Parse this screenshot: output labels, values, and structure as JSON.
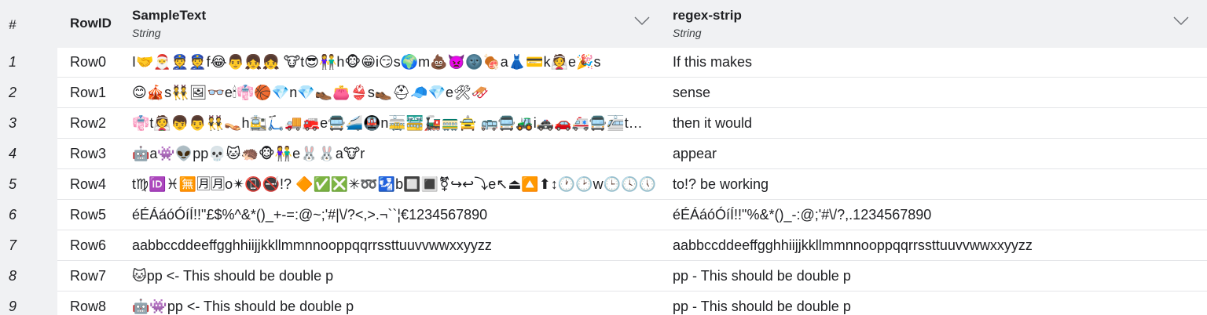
{
  "header": {
    "index_label": "#",
    "rowid_label": "RowID",
    "columns": [
      {
        "name": "SampleText",
        "type": "String"
      },
      {
        "name": "regex-strip",
        "type": "String"
      }
    ],
    "dropdown_icon": "chevron-down-icon"
  },
  "rows": [
    {
      "index": "1",
      "rowid": "Row0",
      "sample": "I🤝🎅👮👮f😂👨👧👧 🐮t😎👫h🐵😁i😏s🌍m💩👿🌚🍖a👗💳k👰e🎉s",
      "strip": "If  this makes"
    },
    {
      "index": "2",
      "rowid": "Row1",
      "sample": "😊🎪s👯🖼👓e🕯👘🏀💎n💎👞👛👙s👞⛑🧢💎e🛠🛷",
      "strip": "sense"
    },
    {
      "index": "3",
      "rowid": "Row2",
      "sample": "👘t👰👦👨👯👡h🚉🛴🚚🚒e🚍🚄🚇n🚋🚟🚂🚃🚖 🚌🚍🚜i🚓🚗🚑🚍🚈t🚃🚃🚃 🚡🚡🚡",
      "strip": "then it would"
    },
    {
      "index": "4",
      "rowid": "Row3",
      "sample": "🤖a👾👽pp💀🐱🦔🐵👫e🐰🐰a🐮r",
      "strip": "appear"
    },
    {
      "index": "5",
      "rowid": "Row4",
      "sample": "t♍🆔♓🈚🈷🈷o✴📵🚭!? 🔶✅❎✳➿🛂b🔲🔳⚧↪↩⤵e↖⏏🔼⬆↕🕐🕑w🕒🕓🕔",
      "strip": "to!? be working"
    },
    {
      "index": "6",
      "rowid": "Row5",
      "sample": "éÉÁáóÓíÍ!!\"£$%^&*()_+-=:@~;'#|\\/?<,>.¬``¦€1234567890",
      "strip": "éÉÁáóÓíÍ!!\"%&*()_-:@;'#\\/?,.1234567890"
    },
    {
      "index": "7",
      "rowid": "Row6",
      "sample": "aabbccddeeffgghhiijjkkllmmnnooppqqrrssttuuvvwwxxyyzz",
      "strip": "aabbccddeeffgghhiijjkkllmmnnooppqqrrssttuuvvwwxxyyzz"
    },
    {
      "index": "8",
      "rowid": "Row7",
      "sample": "🐱pp <- This should be double p",
      "strip": "pp - This should be double p"
    },
    {
      "index": "9",
      "rowid": "Row8",
      "sample": "🤖👾pp <- This should be double p",
      "strip": "pp - This should be double p"
    }
  ]
}
